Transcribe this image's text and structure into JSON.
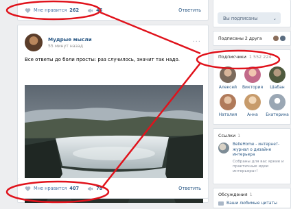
{
  "post_top": {
    "like_label": "Мне нравится",
    "like_count": "262",
    "repost_count": "46",
    "reply_label": "Ответить"
  },
  "post": {
    "author": "Мудрые мысли",
    "time": "55 минут назад",
    "text": "Все ответы до боли просты: раз случилось, значит так надо.",
    "dots": "···",
    "like_label": "Мне нравится",
    "like_count": "407",
    "repost_count": "78",
    "reply_label": "Ответить"
  },
  "sidebar": {
    "subscribe_label": "Вы подписаны",
    "subscribe_caret": "⌄",
    "friends_label": "Подписаны 2 друга",
    "subscribers_label": "Подписчики",
    "subscribers_count": "1 552 224",
    "subscribers": [
      {
        "name": "Алексей",
        "color": "#7b6a5c"
      },
      {
        "name": "Виктория",
        "color": "#c26a8a"
      },
      {
        "name": "Шабан",
        "color": "#4f5a3e"
      },
      {
        "name": "Наталия",
        "color": "#b07a5a"
      },
      {
        "name": "Анна",
        "color": "#c79b6b"
      },
      {
        "name": "Екатерина",
        "color": "#9aa7b4"
      }
    ],
    "links_label": "Ссылки",
    "links_count": "1",
    "link_title": "BelleHome - интернет-журнал о дизайне интерьера",
    "link_desc": "Собраны для вас яркие и практичные идеи интерьера»!",
    "discussions_label": "Обсуждения",
    "discussions_count": "1",
    "discussion_item": "Ваши любимые цитаты"
  },
  "colors": {
    "accent": "#2a5885",
    "annotation": "#e0121b",
    "background": "#edeef0"
  }
}
